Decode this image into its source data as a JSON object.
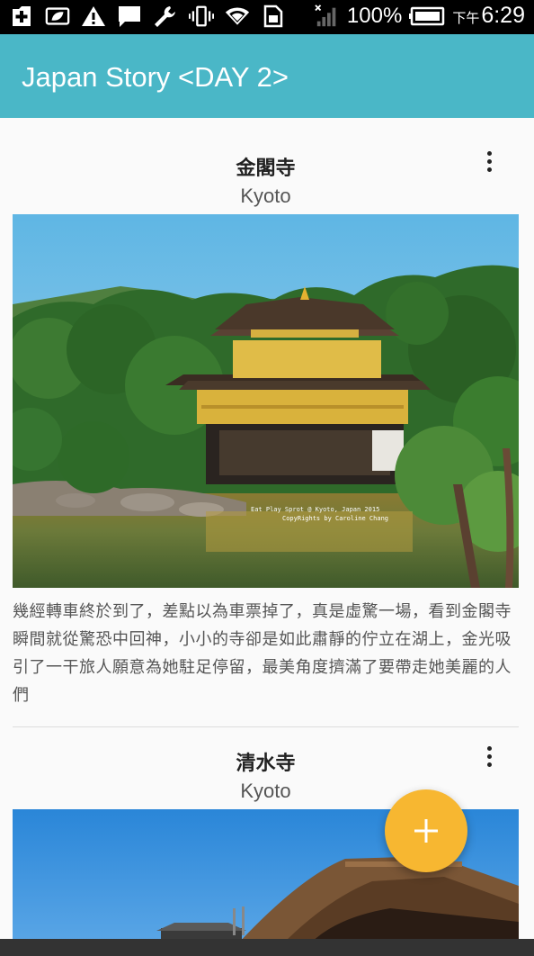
{
  "status_bar": {
    "battery_percent": "100%",
    "clock_ampm": "下午",
    "clock_time": "6:29",
    "icons": [
      "add-box-icon",
      "leaf-icon",
      "warning-icon",
      "message-icon",
      "wrench-icon",
      "vibrate-icon",
      "wifi-icon",
      "sim-icon",
      "signal-icon",
      "battery-icon"
    ]
  },
  "app_bar": {
    "title": "Japan Story <DAY 2>"
  },
  "colors": {
    "app_bar": "#4ab7c7",
    "fab": "#f7b731",
    "background": "#fafafa"
  },
  "cards": [
    {
      "title": "金閣寺",
      "subtitle": "Kyoto",
      "image_watermark_line1": "Eat Play Sprot @ Kyoto, Japan 2015",
      "image_watermark_line2": "CopyRights by Caroline Chang",
      "description": "幾經轉車終於到了，差點以為車票掉了，真是虛驚一場，看到金閣寺瞬間就從驚恐中回神，小小的寺卻是如此肅靜的佇立在湖上，金光吸引了一干旅人願意為她駐足停留，最美角度擠滿了要帶走她美麗的人們"
    },
    {
      "title": "清水寺",
      "subtitle": "Kyoto"
    }
  ],
  "fab": {
    "icon": "plus-icon"
  }
}
